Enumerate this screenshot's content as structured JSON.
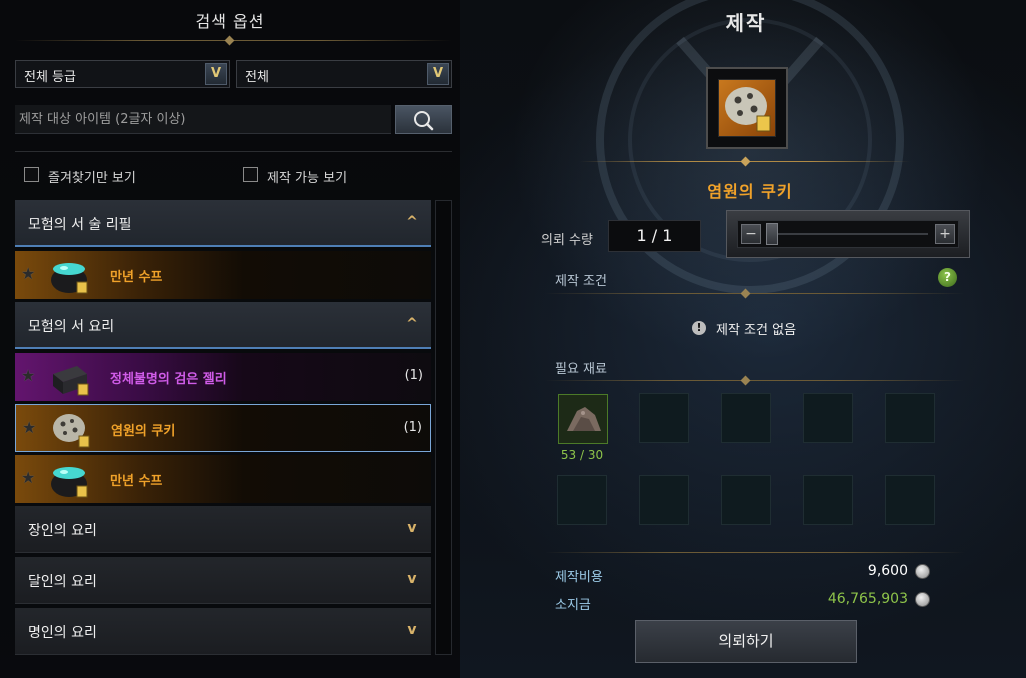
{
  "search_options": {
    "title": "검색 옵션",
    "grade_dropdown": "전체 등급",
    "type_dropdown": "전체",
    "search_placeholder": "제작 대상 아이템 (2글자 이상)",
    "favorites_only": "즐겨찾기만 보기",
    "craftable_only": "제작 가능 보기"
  },
  "recipe_list": [
    {
      "category": "모험의 서 술 리필",
      "expanded": true,
      "items": [
        {
          "name": "만년 수프",
          "count": "",
          "rarity": "legendary",
          "icon": "cauldron-icon"
        }
      ]
    },
    {
      "category": "모험의 서 요리",
      "expanded": true,
      "items": [
        {
          "name": "정체불명의 검은 젤리",
          "count": "(1)",
          "rarity": "epic",
          "icon": "jelly-icon"
        },
        {
          "name": "염원의 쿠키",
          "count": "(1)",
          "rarity": "legendary",
          "icon": "cookie-icon",
          "selected": true
        },
        {
          "name": "만년 수프",
          "count": "",
          "rarity": "legendary",
          "icon": "cauldron-icon"
        }
      ]
    },
    {
      "category": "장인의 요리",
      "expanded": false,
      "items": []
    },
    {
      "category": "달인의 요리",
      "expanded": false,
      "items": []
    },
    {
      "category": "명인의 요리",
      "expanded": false,
      "items": []
    }
  ],
  "craft": {
    "title": "제작",
    "item_name": "염원의 쿠키",
    "item_icon": "cookie-icon",
    "quantity_label": "의뢰 수량",
    "quantity_value": "1 / 1",
    "conditions_label": "제작 조건",
    "no_conditions": "제작 조건 없음",
    "materials_label": "필요 재료",
    "materials": [
      {
        "icon": "ore-pile-icon",
        "count": "53 / 30"
      }
    ],
    "cost_label": "제작비용",
    "cost_value": "9,600",
    "money_label": "소지금",
    "money_value": "46,765,903",
    "commission_button": "의뢰하기"
  },
  "colors": {
    "legendary": "#f0a22a",
    "epic": "#d05ce8",
    "selected_border": "#7aa7d8",
    "enough_material": "#8ec44a",
    "money": "#8ec44a",
    "cost": "#ffffff"
  }
}
